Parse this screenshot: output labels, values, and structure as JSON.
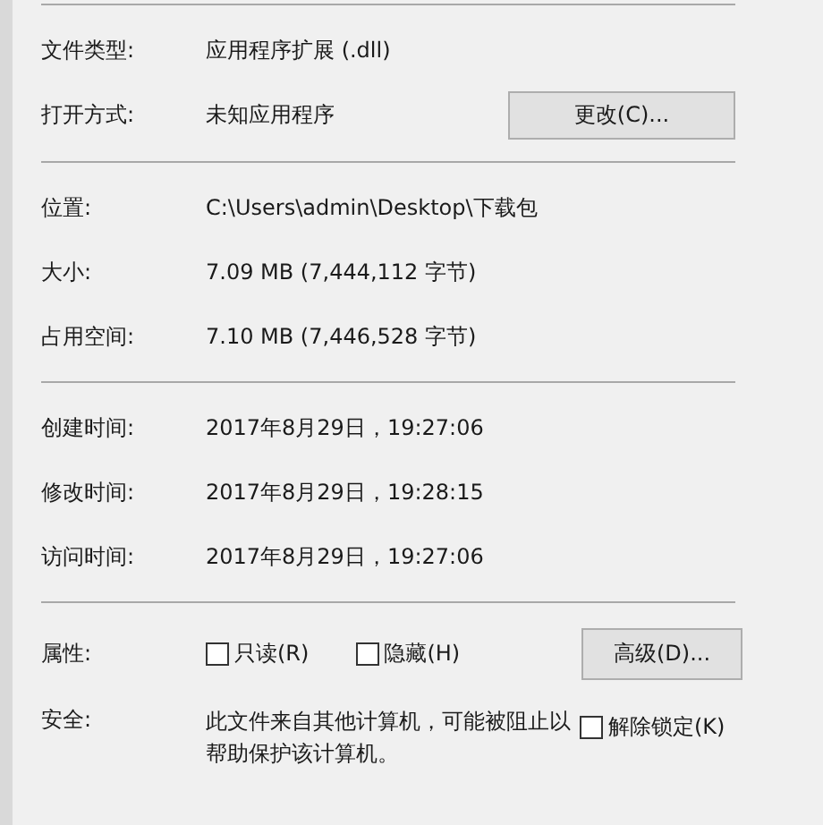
{
  "groups": [
    {
      "rows": [
        {
          "label": "文件类型:",
          "value": "应用程序扩展 (.dll)"
        },
        {
          "label": "打开方式:",
          "value": "未知应用程序",
          "button": "更改(C)..."
        }
      ]
    },
    {
      "rows": [
        {
          "label": "位置:",
          "value": "C:\\Users\\admin\\Desktop\\下载包"
        },
        {
          "label": "大小:",
          "value": "7.09 MB (7,444,112 字节)"
        },
        {
          "label": "占用空间:",
          "value": "7.10 MB (7,446,528 字节)"
        }
      ]
    },
    {
      "rows": [
        {
          "label": "创建时间:",
          "value": "2017年8月29日，19:27:06"
        },
        {
          "label": "修改时间:",
          "value": "2017年8月29日，19:28:15"
        },
        {
          "label": "访问时间:",
          "value": "2017年8月29日，19:27:06"
        }
      ]
    }
  ],
  "attributes": {
    "label": "属性:",
    "checkboxes": [
      {
        "label": "只读(R)",
        "checked": false
      },
      {
        "label": "隐藏(H)",
        "checked": false
      }
    ],
    "button": "高级(D)..."
  },
  "security": {
    "label": "安全:",
    "text": "此文件来自其他计算机，可能被阻止以帮助保护该计算机。",
    "checkbox": {
      "label": "解除锁定(K)",
      "checked": false
    }
  }
}
